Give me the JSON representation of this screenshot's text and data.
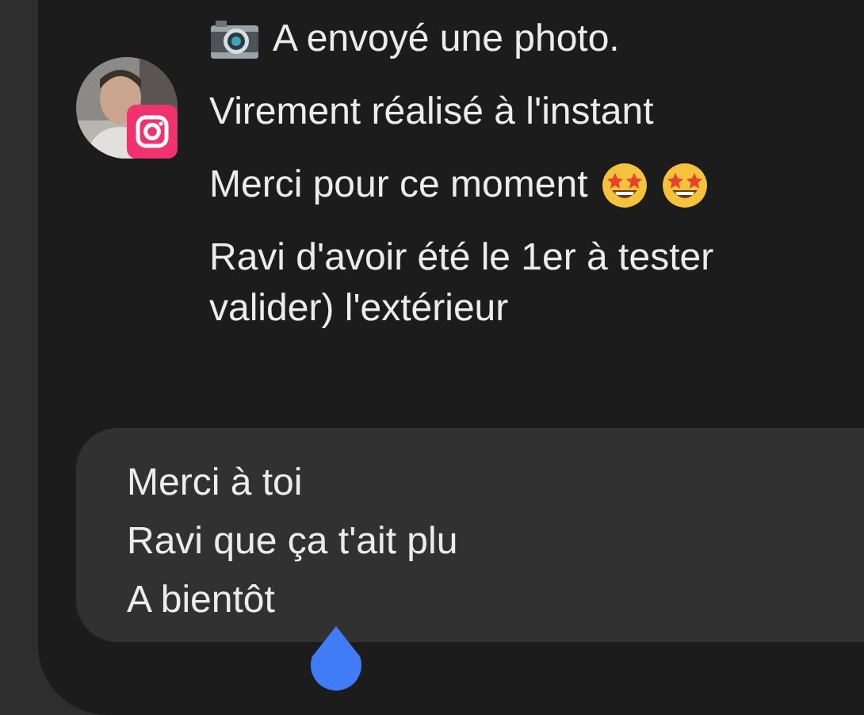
{
  "messages": [
    {
      "text": "A envoyé une photo."
    },
    {
      "kind": "text",
      "text": "Virement réalisé à l'instant"
    },
    {
      "kind": "emoji",
      "text": "Merci pour ce moment"
    },
    {
      "kind": "text",
      "text": "Ravi d'avoir été le 1er à tester\nvalider) l'extérieur"
    }
  ],
  "reply_field": {
    "value": "Merci à toi\nRavi que ça t'ait plu\nA bientôt"
  }
}
